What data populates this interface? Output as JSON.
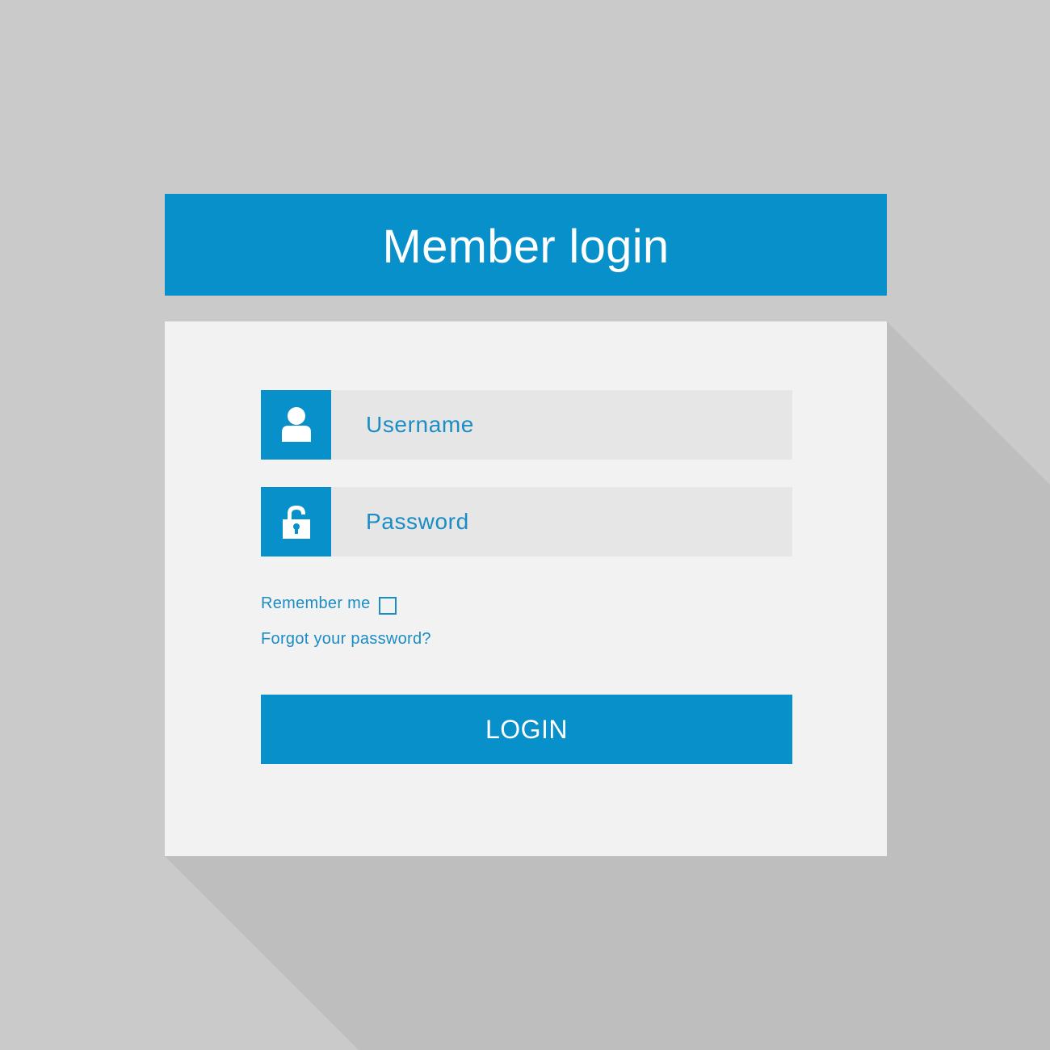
{
  "header": {
    "title": "Member login"
  },
  "form": {
    "username": {
      "placeholder": "Username",
      "value": "",
      "icon": "user-icon"
    },
    "password": {
      "placeholder": "Password",
      "value": "",
      "icon": "lock-icon"
    },
    "remember_label": "Remember me",
    "remember_checked": false,
    "forgot_label": "Forgot your password?",
    "login_label": "LOGIN"
  },
  "colors": {
    "accent": "#0890ca",
    "text_accent": "#1a8dc4",
    "background": "#cacaca",
    "panel": "#f2f2f2",
    "input_bg": "#e6e6e6"
  }
}
